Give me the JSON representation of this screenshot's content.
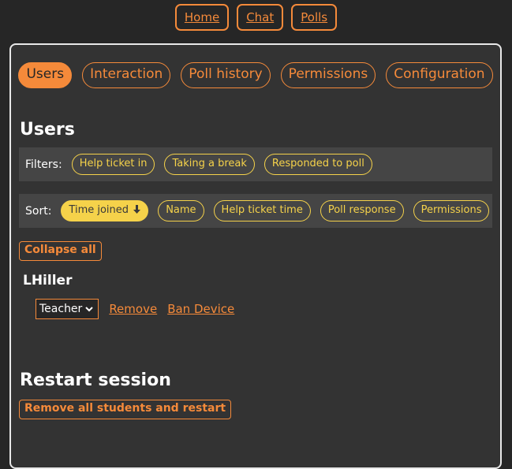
{
  "nav": {
    "home": "Home",
    "chat": "Chat",
    "polls": "Polls"
  },
  "tabs": [
    {
      "label": "Users",
      "active": true
    },
    {
      "label": "Interaction"
    },
    {
      "label": "Poll history"
    },
    {
      "label": "Permissions"
    },
    {
      "label": "Configuration"
    }
  ],
  "users_heading": "Users",
  "filters": {
    "label": "Filters:",
    "items": [
      "Help ticket in",
      "Taking a break",
      "Responded to poll"
    ]
  },
  "sort": {
    "label": "Sort:",
    "active_label": "Time joined",
    "active_icon": "arrow-down-icon",
    "items": [
      "Name",
      "Help ticket time",
      "Poll response",
      "Permissions"
    ]
  },
  "collapse_all": "Collapse all",
  "user": {
    "name": "LHiller",
    "role": "Teacher",
    "remove": "Remove",
    "ban_device": "Ban Device"
  },
  "restart": {
    "heading": "Restart session",
    "button": "Remove all students and restart"
  },
  "colors": {
    "accent": "#f58a3a",
    "chip": "#f5d24a",
    "background": "#262626",
    "panel": "#333333"
  }
}
